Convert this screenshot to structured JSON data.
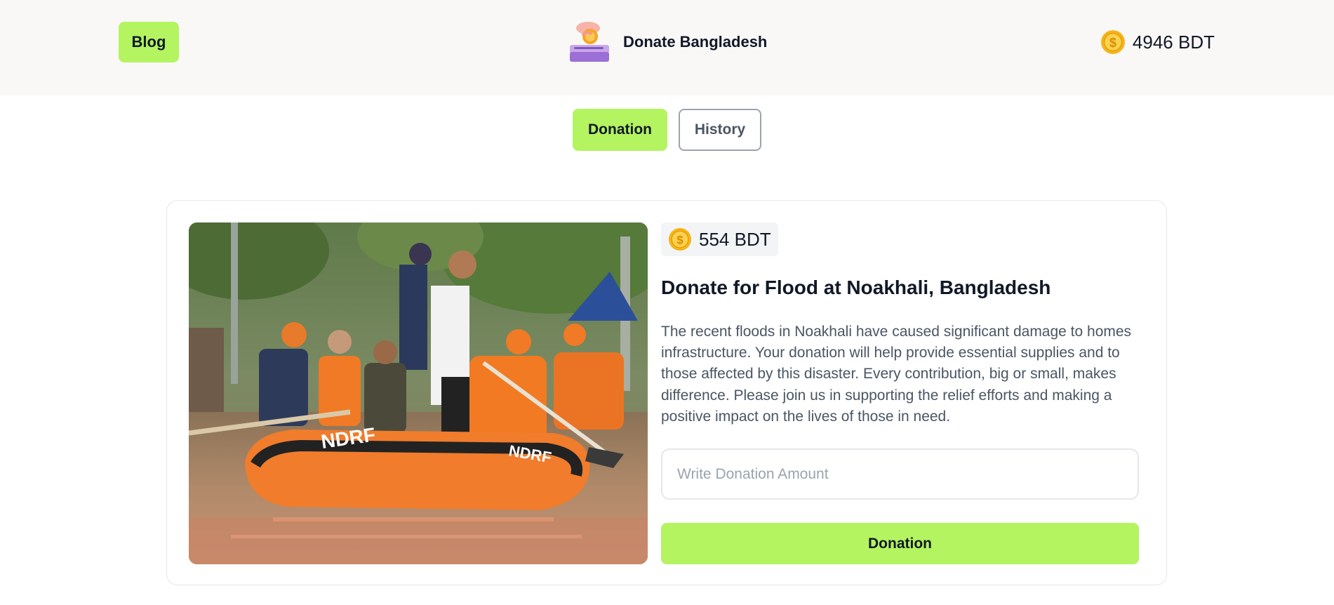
{
  "header": {
    "blog_label": "Blog",
    "brand_title": "Donate Bangladesh",
    "balance": "4946 BDT",
    "brand_logo_icon": "donation-box-icon",
    "balance_icon": "gold-coin-icon"
  },
  "tabs": [
    {
      "label": "Donation",
      "active": true
    },
    {
      "label": "History",
      "active": false
    }
  ],
  "card": {
    "image_alt": "Rescue workers in orange life jackets rowing an inflatable boat through flood water",
    "amount": "554 BDT",
    "amount_icon": "gold-coin-icon",
    "title": "Donate for Flood at Noakhali, Bangladesh",
    "description": "The recent floods in Noakhali have caused significant damage to homes infrastructure. Your donation will help provide essential supplies and to those affected by this disaster. Every contribution, big or small, makes difference. Please join us in supporting the relief efforts and making a positive impact on the lives of those in need.",
    "input_placeholder": "Write Donation Amount",
    "input_value": "",
    "button_label": "Donation"
  },
  "colors": {
    "accent": "#b4f461",
    "header_bg": "#f9f8f7",
    "text_dark": "#111827",
    "text_muted": "#4b5563",
    "coin": "#f5b41a"
  }
}
